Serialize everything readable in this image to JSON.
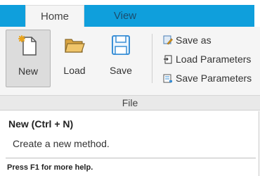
{
  "tabs": {
    "home_label": "Home",
    "view_label": "View",
    "active": "Home"
  },
  "ribbon": {
    "new_label": "New",
    "load_label": "Load",
    "save_label": "Save",
    "save_as_label": "Save as",
    "load_parameters_label": "Load Parameters",
    "save_parameters_label": "Save Parameters",
    "group_label": "File"
  },
  "tooltip": {
    "title": "New (Ctrl + N)",
    "description": "Create a new method.",
    "help": "Press F1 for more help."
  },
  "icons": {
    "new": "new-document-icon",
    "load": "folder-open-icon",
    "save": "floppy-disk-icon",
    "save_as": "save-as-icon",
    "load_parameters": "load-parameters-icon",
    "save_parameters": "save-parameters-icon"
  },
  "colors": {
    "tab_band": "#0f9fdc",
    "ribbon_bg": "#f5f5f5",
    "icon_accent": "#3a8fd6"
  }
}
